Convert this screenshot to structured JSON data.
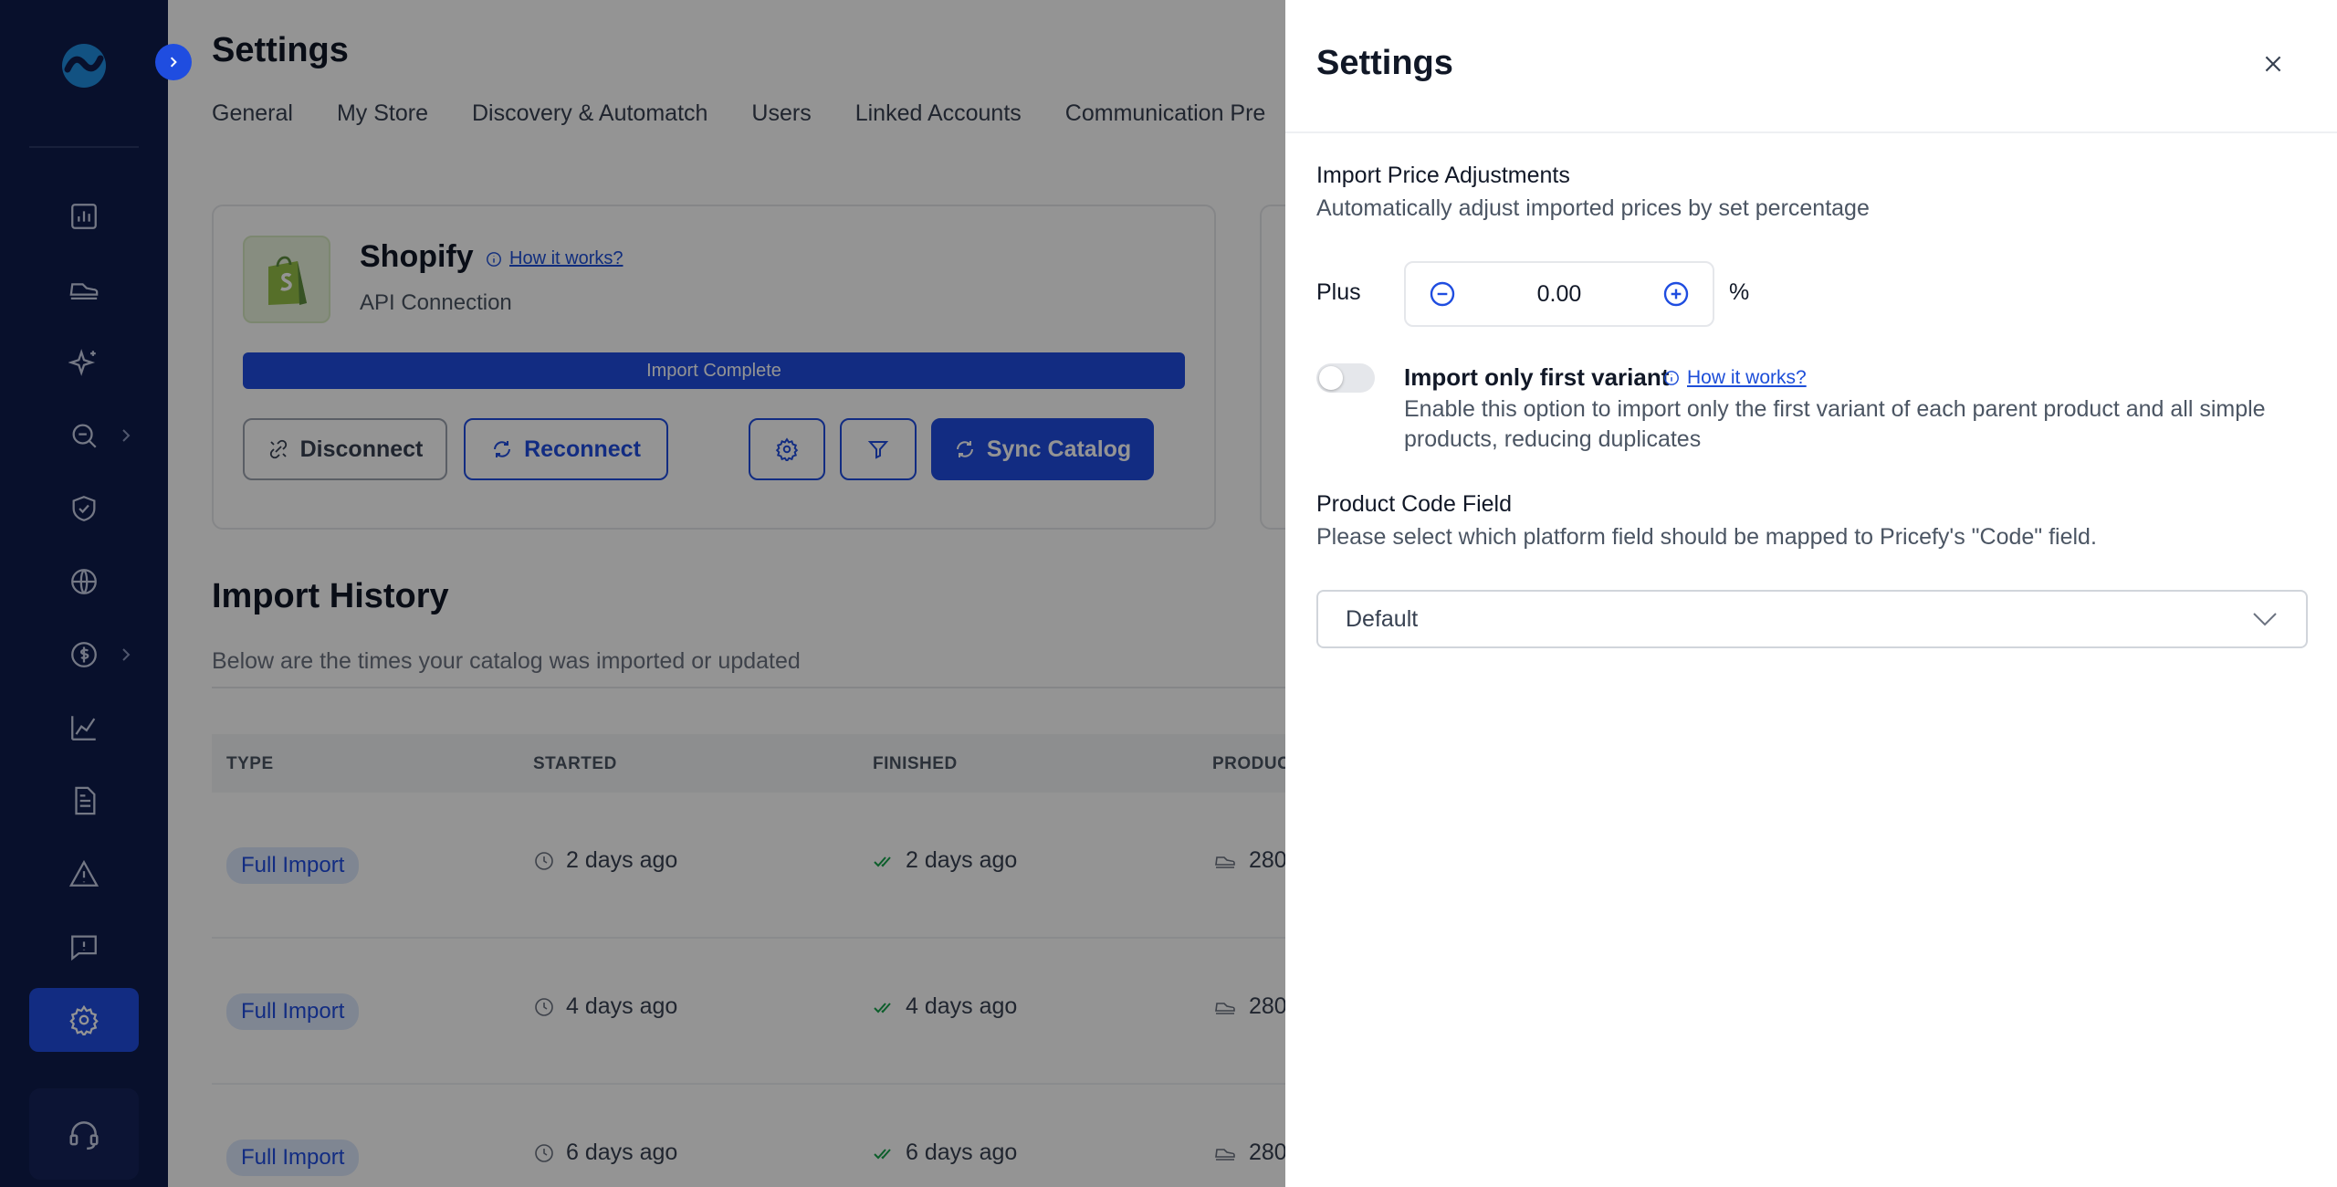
{
  "page": {
    "title": "Settings",
    "tabs": [
      "General",
      "My Store",
      "Discovery & Automatch",
      "Users",
      "Linked Accounts",
      "Communication Pre"
    ]
  },
  "integration": {
    "name": "Shopify",
    "how_it_works": "How it works?",
    "subtitle": "API Connection",
    "status": "Import Complete",
    "progress_fraction": 1.0,
    "disconnect_label": "Disconnect",
    "reconnect_label": "Reconnect",
    "sync_label": "Sync Catalog"
  },
  "import_history": {
    "title": "Import History",
    "subtitle": "Below are the times your catalog was imported or updated",
    "columns": [
      "TYPE",
      "STARTED",
      "FINISHED",
      "PRODUC"
    ],
    "rows": [
      {
        "type": "Full Import",
        "started": "2 days ago",
        "finished": "2 days ago",
        "products": "280"
      },
      {
        "type": "Full Import",
        "started": "4 days ago",
        "finished": "4 days ago",
        "products": "280"
      },
      {
        "type": "Full Import",
        "started": "6 days ago",
        "finished": "6 days ago",
        "products": "280"
      }
    ]
  },
  "drawer": {
    "title": "Settings",
    "price_adjust_label": "Import Price Adjustments",
    "price_adjust_desc": "Automatically adjust imported prices by set percentage",
    "plus_label": "Plus",
    "stepper_value": "0.00",
    "percent_symbol": "%",
    "variant_label": "Import only first variant",
    "variant_link": "How it works?",
    "variant_desc": "Enable this option to import only the first variant of each parent product and all simple products, reducing duplicates",
    "variant_enabled": false,
    "code_field_label": "Product Code Field",
    "code_field_desc": "Please select which platform field should be mapped to Pricefy's \"Code\" field.",
    "code_field_value": "Default"
  },
  "colors": {
    "sidebar": "#0f1c4d",
    "accent": "#1f4de0",
    "link": "#1d4ed8"
  }
}
